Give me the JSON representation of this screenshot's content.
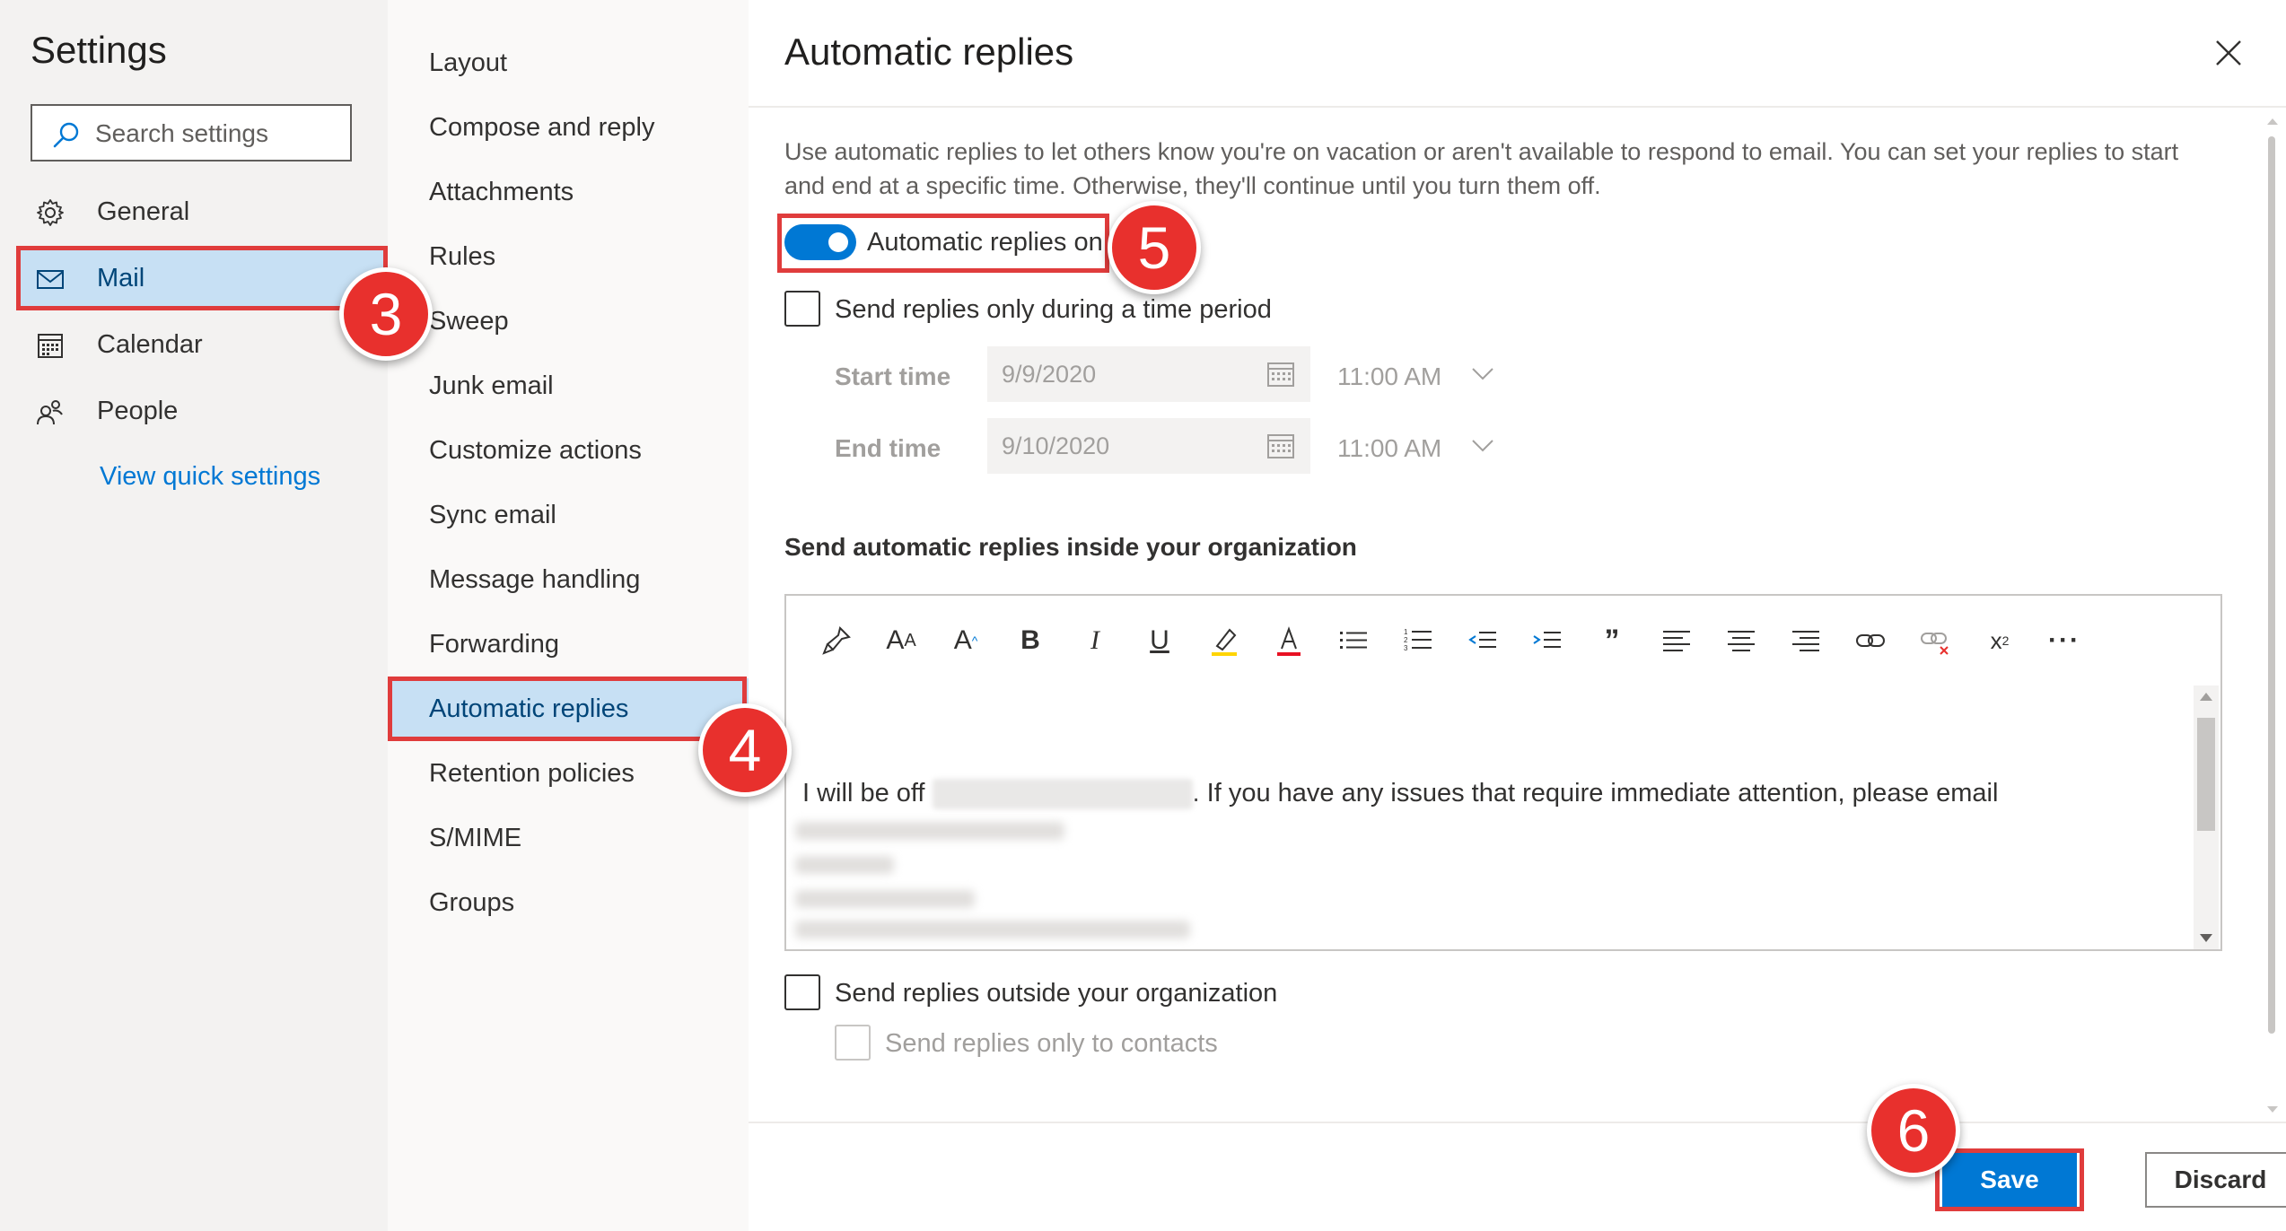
{
  "left_nav": {
    "title": "Settings",
    "search_placeholder": "Search settings",
    "items": [
      {
        "label": "General",
        "icon": "gear-icon"
      },
      {
        "label": "Mail",
        "icon": "mail-icon",
        "selected": true
      },
      {
        "label": "Calendar",
        "icon": "calendar-icon"
      },
      {
        "label": "People",
        "icon": "people-icon"
      }
    ],
    "view_quick_settings": "View quick settings"
  },
  "mail_nav": {
    "items": [
      "Layout",
      "Compose and reply",
      "Attachments",
      "Rules",
      "Sweep",
      "Junk email",
      "Customize actions",
      "Sync email",
      "Message handling",
      "Forwarding",
      "Automatic replies",
      "Retention policies",
      "S/MIME",
      "Groups"
    ],
    "selected": "Automatic replies"
  },
  "panel": {
    "title": "Automatic replies",
    "description": "Use automatic replies to let others know you're on vacation or aren't available to respond to email. You can set your replies to start and end at a specific time. Otherwise, they'll continue until you turn them off.",
    "toggle_label": "Automatic replies on",
    "toggle_on": true,
    "time_period_label": "Send replies only during a time period",
    "start_label": "Start time",
    "start_date": "9/9/2020",
    "start_time": "11:00 AM",
    "end_label": "End time",
    "end_date": "9/10/2020",
    "end_time": "11:00 AM",
    "inside_heading": "Send automatic replies inside your organization",
    "editor_text_before": "I will be off",
    "editor_text_after": ". If you have any issues that require immediate attention, please email",
    "outside_label": "Send replies outside your organization",
    "contacts_only_label": "Send replies only to contacts",
    "save_label": "Save",
    "discard_label": "Discard"
  },
  "toolbar_icons": [
    "format-painter-icon",
    "font-size-icon",
    "grow-font-icon",
    "bold-icon",
    "italic-icon",
    "underline-icon",
    "highlight-icon",
    "font-color-icon",
    "bullets-icon",
    "numbering-icon",
    "decrease-indent-icon",
    "increase-indent-icon",
    "quote-icon",
    "align-left-icon",
    "align-center-icon",
    "align-right-icon",
    "link-icon",
    "unlink-icon",
    "superscript-icon",
    "more-icon"
  ],
  "annotations": [
    {
      "number": "3"
    },
    {
      "number": "4"
    },
    {
      "number": "5"
    },
    {
      "number": "6"
    }
  ],
  "colors": {
    "accent": "#0078d4",
    "selected_bg": "#c7e0f4",
    "annotation": "#e8302d"
  }
}
